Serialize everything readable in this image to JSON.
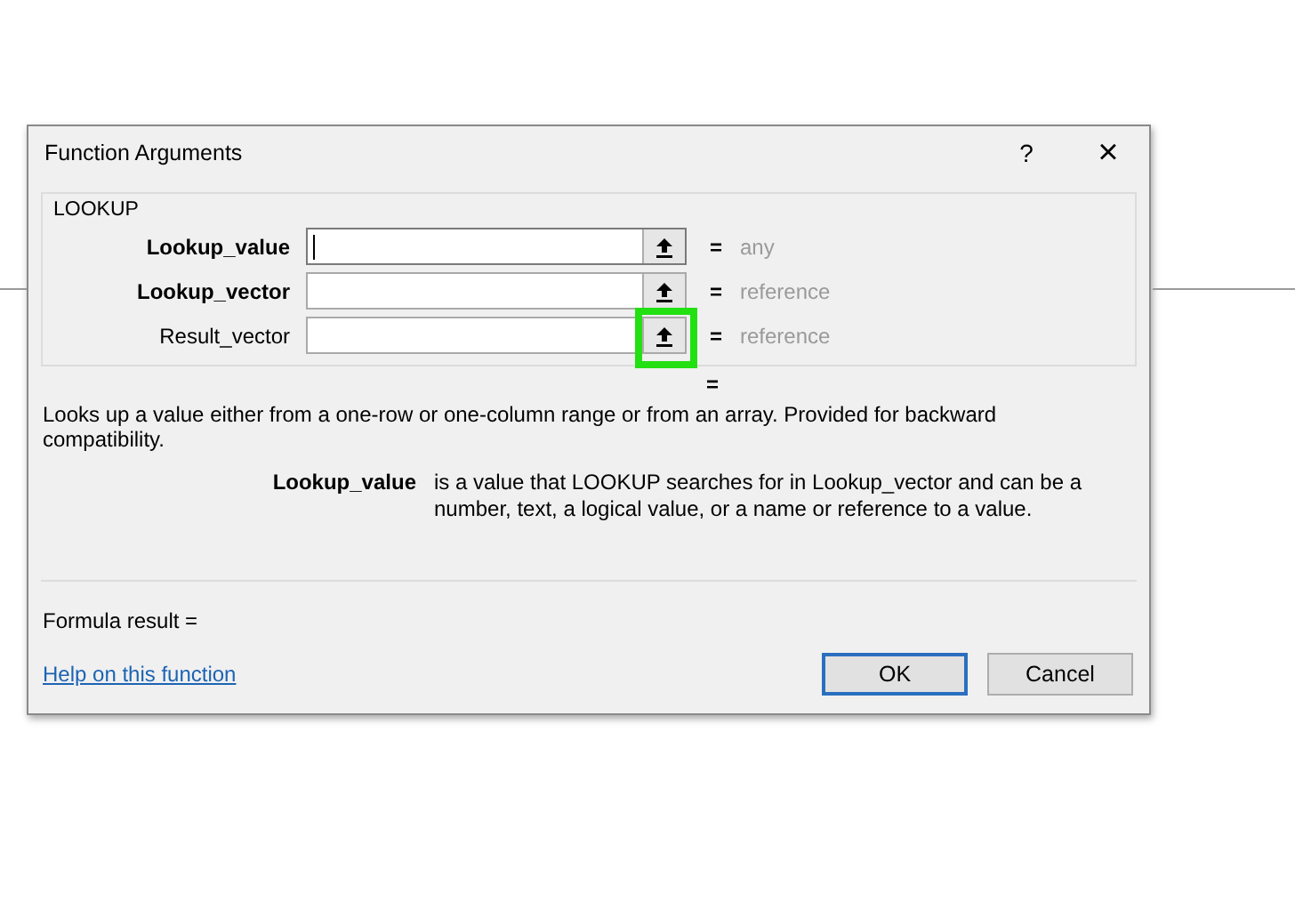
{
  "dialog": {
    "title": "Function Arguments",
    "help": "?",
    "close": "×",
    "function_name": "LOOKUP",
    "arguments": [
      {
        "label": "Lookup_value",
        "required": true,
        "focused": true,
        "highlighted": false,
        "equals": "=",
        "hint": "any"
      },
      {
        "label": "Lookup_vector",
        "required": true,
        "focused": false,
        "highlighted": false,
        "equals": "=",
        "hint": "reference"
      },
      {
        "label": "Result_vector",
        "required": false,
        "focused": false,
        "highlighted": true,
        "equals": "=",
        "hint": "reference"
      }
    ],
    "result_equals": "=",
    "description": "Looks up a value either from a one-row or one-column range or from an array. Provided for backward compatibility.",
    "argument_help": {
      "label": "Lookup_value",
      "text": "is a value that LOOKUP searches for in Lookup_vector and can be a number, text, a logical value, or a name or reference to a value."
    },
    "formula_result": "Formula result =",
    "help_link": "Help on this function",
    "buttons": [
      {
        "label": "OK",
        "default": true
      },
      {
        "label": "Cancel",
        "default": false
      }
    ]
  }
}
